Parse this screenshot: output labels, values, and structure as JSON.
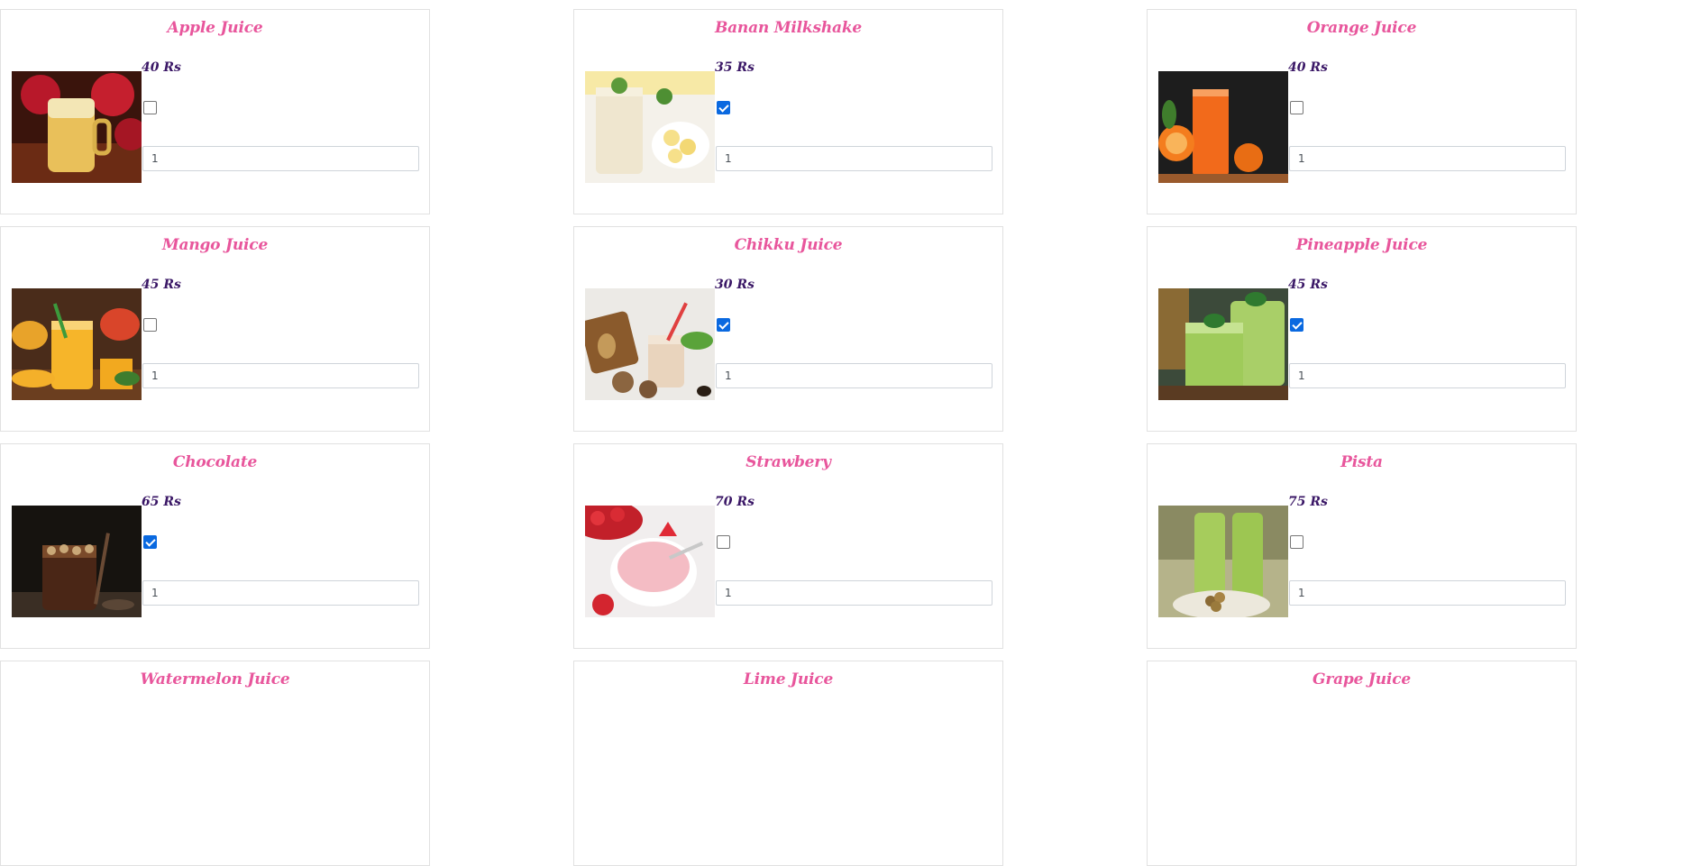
{
  "products": [
    {
      "name": "Apple Juice",
      "price": "40 Rs",
      "checked": false,
      "quantity": "1",
      "image": "apple-juice"
    },
    {
      "name": "Banan Milkshake",
      "price": "35 Rs",
      "checked": true,
      "quantity": "1",
      "image": "banana-milkshake"
    },
    {
      "name": "Orange Juice",
      "price": "40 Rs",
      "checked": false,
      "quantity": "1",
      "image": "orange-juice"
    },
    {
      "name": "Mango Juice",
      "price": "45 Rs",
      "checked": false,
      "quantity": "1",
      "image": "mango-juice"
    },
    {
      "name": "Chikku Juice",
      "price": "30 Rs",
      "checked": true,
      "quantity": "1",
      "image": "chikku-juice"
    },
    {
      "name": "Pineapple Juice",
      "price": "45 Rs",
      "checked": true,
      "quantity": "1",
      "image": "pineapple-juice"
    },
    {
      "name": "Chocolate",
      "price": "65 Rs",
      "checked": true,
      "quantity": "1",
      "image": "chocolate"
    },
    {
      "name": "Strawbery",
      "price": "70 Rs",
      "checked": false,
      "quantity": "1",
      "image": "strawberry"
    },
    {
      "name": "Pista",
      "price": "75 Rs",
      "checked": false,
      "quantity": "1",
      "image": "pista"
    },
    {
      "name": "Watermelon Juice",
      "image": "watermelon-juice"
    },
    {
      "name": "Lime Juice",
      "image": "lime-juice"
    },
    {
      "name": "Grape Juice",
      "image": "grape-juice"
    }
  ],
  "colors": {
    "title": "#e8569c",
    "price": "#3a1766",
    "checkbox_checked": "#0a69e0",
    "card_border": "#e1e1e1"
  }
}
